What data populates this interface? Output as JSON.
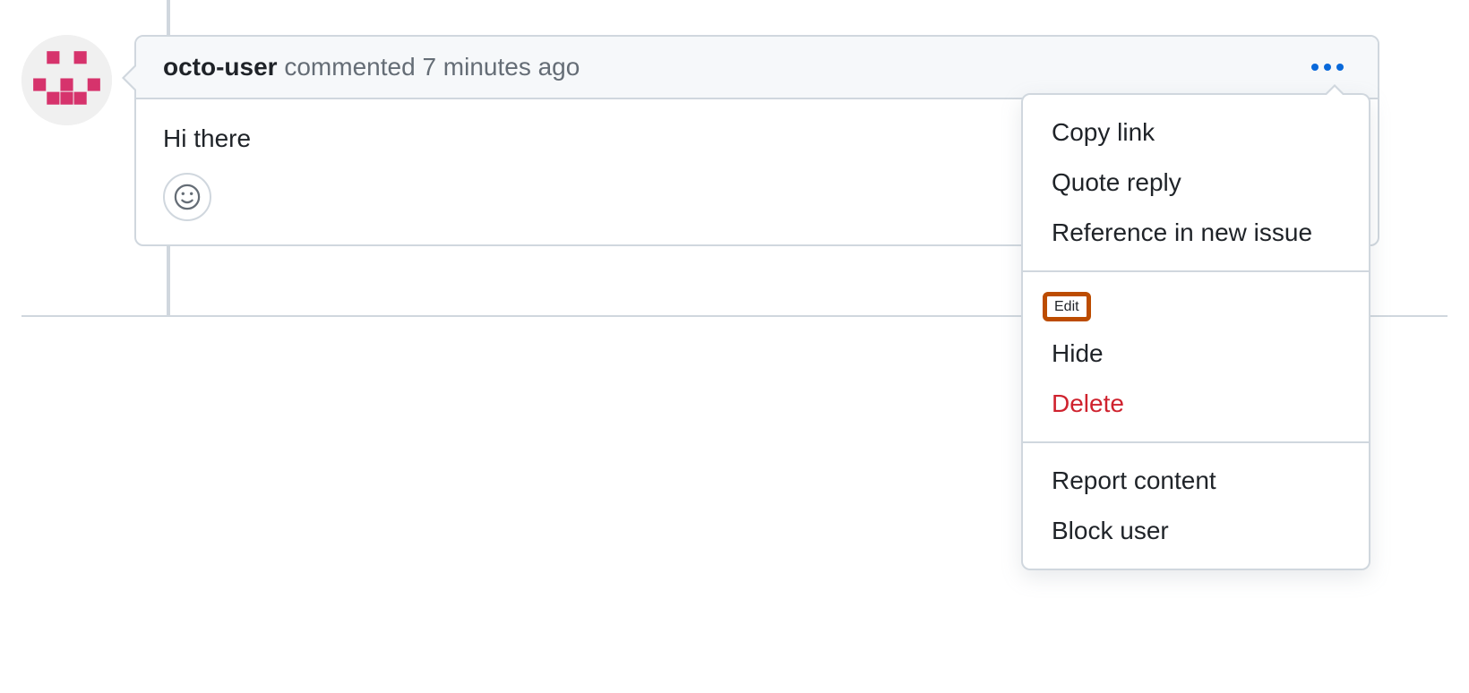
{
  "comment": {
    "author": "octo-user",
    "action_text": "commented",
    "timestamp": "7 minutes ago",
    "body": "Hi there"
  },
  "menu": {
    "group1": {
      "copy_link": "Copy link",
      "quote_reply": "Quote reply",
      "reference_new_issue": "Reference in new issue"
    },
    "group2": {
      "edit": "Edit",
      "hide": "Hide",
      "delete": "Delete"
    },
    "group3": {
      "report_content": "Report content",
      "block_user": "Block user"
    }
  }
}
